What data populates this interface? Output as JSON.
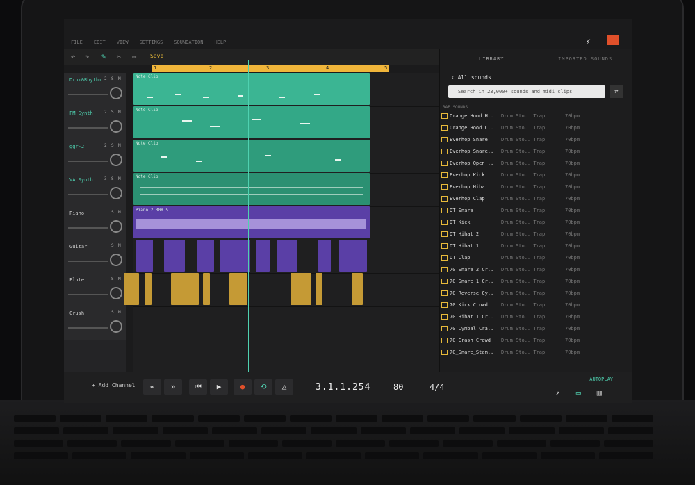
{
  "menu": [
    "FILE",
    "EDIT",
    "VIEW",
    "SETTINGS",
    "SOUNDATION",
    "HELP"
  ],
  "toolbar": {
    "save_label": "Save"
  },
  "ruler": [
    "1",
    "2",
    "3",
    "4",
    "5"
  ],
  "tracks": [
    {
      "name": "Drum&Rhythm",
      "num": "2",
      "color": "#4fd1b0"
    },
    {
      "name": "FM Synth",
      "num": "2",
      "color": "#4fd1b0"
    },
    {
      "name": "ggr-2",
      "num": "2",
      "color": "#4fd1b0"
    },
    {
      "name": "VA Synth",
      "num": "3",
      "color": "#4fd1b0"
    },
    {
      "name": "Piano",
      "num": "",
      "color": "#cfcfcf"
    },
    {
      "name": "Guitar",
      "num": "",
      "color": "#cfcfcf"
    },
    {
      "name": "Flute",
      "num": "",
      "color": "#cfcfcf"
    },
    {
      "name": "Crush",
      "num": "",
      "color": "#cfcfcf"
    }
  ],
  "clips": {
    "note_clip": "Note Clip",
    "piano_clip": "Piano 2 308 5"
  },
  "transport": {
    "add_channel": "+ Add Channel",
    "position": "3.1.1.254",
    "bpm": "80",
    "signature": "4/4"
  },
  "library": {
    "tab_library": "LIBRARY",
    "tab_imported": "IMPORTED SOUNDS",
    "back": "All sounds",
    "search_placeholder": "Search in 23,000+ sounds and midi clips",
    "section": "RAP SOUNDS",
    "autoplay": "AUTOPLAY",
    "items": [
      {
        "name": "Orange Hood H..",
        "tag": "Drum Sto.. Trap",
        "bpm": "70bpm"
      },
      {
        "name": "Orange Hood C..",
        "tag": "Drum Sto.. Trap",
        "bpm": "70bpm"
      },
      {
        "name": "Everhop Snare",
        "tag": "Drum Sto.. Trap",
        "bpm": "70bpm"
      },
      {
        "name": "Everhop Snare..",
        "tag": "Drum Sto.. Trap",
        "bpm": "70bpm"
      },
      {
        "name": "Everhop Open ..",
        "tag": "Drum Sto.. Trap",
        "bpm": "70bpm"
      },
      {
        "name": "Everhop Kick",
        "tag": "Drum Sto.. Trap",
        "bpm": "70bpm"
      },
      {
        "name": "Everhop Hihat",
        "tag": "Drum Sto.. Trap",
        "bpm": "70bpm"
      },
      {
        "name": "Everhop Clap",
        "tag": "Drum Sto.. Trap",
        "bpm": "70bpm"
      },
      {
        "name": "DT Snare",
        "tag": "Drum Sto.. Trap",
        "bpm": "70bpm"
      },
      {
        "name": "DT Kick",
        "tag": "Drum Sto.. Trap",
        "bpm": "70bpm"
      },
      {
        "name": "DT Hihat 2",
        "tag": "Drum Sto.. Trap",
        "bpm": "70bpm"
      },
      {
        "name": "DT Hihat 1",
        "tag": "Drum Sto.. Trap",
        "bpm": "70bpm"
      },
      {
        "name": "DT Clap",
        "tag": "Drum Sto.. Trap",
        "bpm": "70bpm"
      },
      {
        "name": "70 Snare 2 Cr..",
        "tag": "Drum Sto.. Trap",
        "bpm": "70bpm"
      },
      {
        "name": "70 Snare 1 Cr..",
        "tag": "Drum Sto.. Trap",
        "bpm": "70bpm"
      },
      {
        "name": "70 Reverse Cy..",
        "tag": "Drum Sto.. Trap",
        "bpm": "70bpm"
      },
      {
        "name": "70 Kick Crowd",
        "tag": "Drum Sto.. Trap",
        "bpm": "70bpm"
      },
      {
        "name": "70 Hihat 1 Cr..",
        "tag": "Drum Sto.. Trap",
        "bpm": "70bpm"
      },
      {
        "name": "70 Cymbal Cra..",
        "tag": "Drum Sto.. Trap",
        "bpm": "70bpm"
      },
      {
        "name": "70 Crash Crowd",
        "tag": "Drum Sto.. Trap",
        "bpm": "70bpm"
      },
      {
        "name": "70_Snare_Stam..",
        "tag": "Drum Sto.. Trap",
        "bpm": "70bpm"
      }
    ]
  }
}
